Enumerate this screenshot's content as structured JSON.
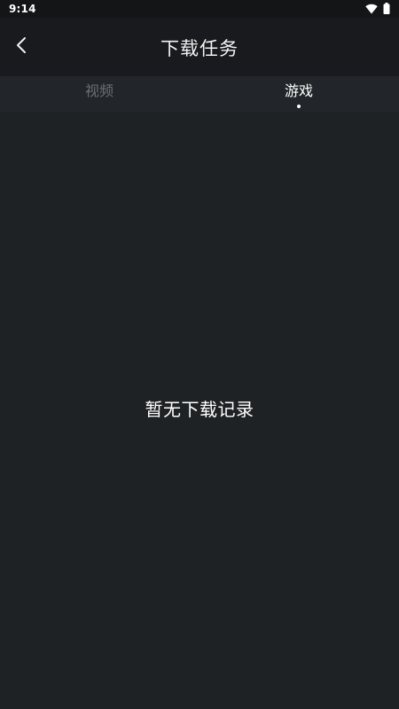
{
  "status_bar": {
    "time": "9:14",
    "icons": [
      "wifi-icon",
      "battery-icon"
    ]
  },
  "header": {
    "title": "下载任务",
    "back_icon": "chevron-left-icon"
  },
  "tabs": [
    {
      "label": "视频",
      "selected": false
    },
    {
      "label": "游戏",
      "selected": true
    }
  ],
  "empty_state": {
    "message": "暂无下载记录"
  },
  "colors": {
    "background": "#1f2225",
    "header": "#181a1d",
    "tab_active": "#ffffff",
    "tab_inactive": "#6c7075"
  }
}
